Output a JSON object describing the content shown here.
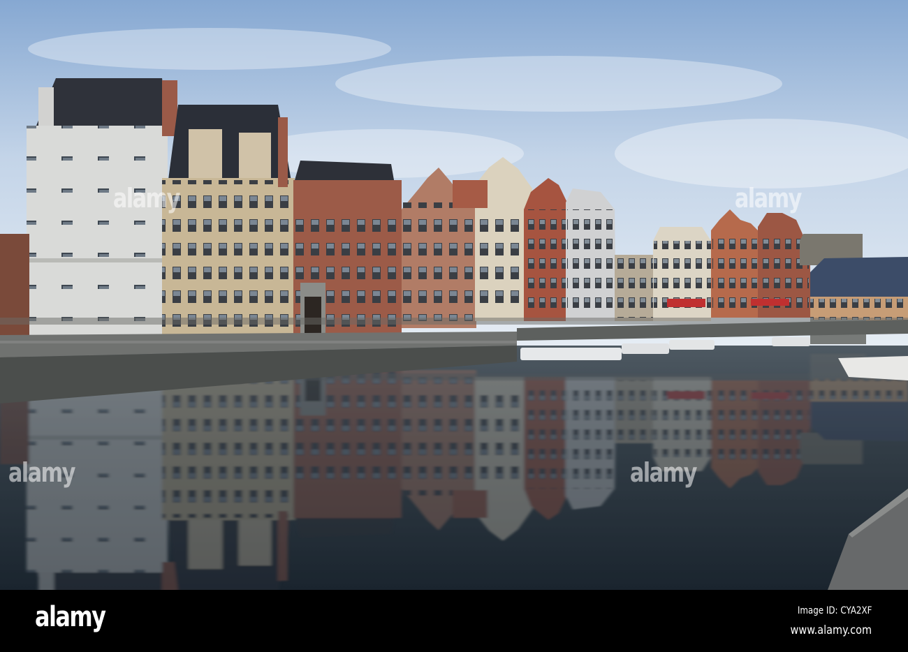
{
  "photo": {
    "subject": "Graslei canal quay with historic guild houses",
    "colors": {
      "sky_top": "#8fb0d6",
      "sky_bottom": "#e4ecf4",
      "water_top": "#5d6a72",
      "water_bottom": "#1b2630",
      "roof": "#2f323a"
    }
  },
  "watermark": {
    "text": "alamy"
  },
  "footer": {
    "logo": "alamy",
    "image_id": "Image ID: CYA2XF",
    "url": "www.alamy.com"
  }
}
